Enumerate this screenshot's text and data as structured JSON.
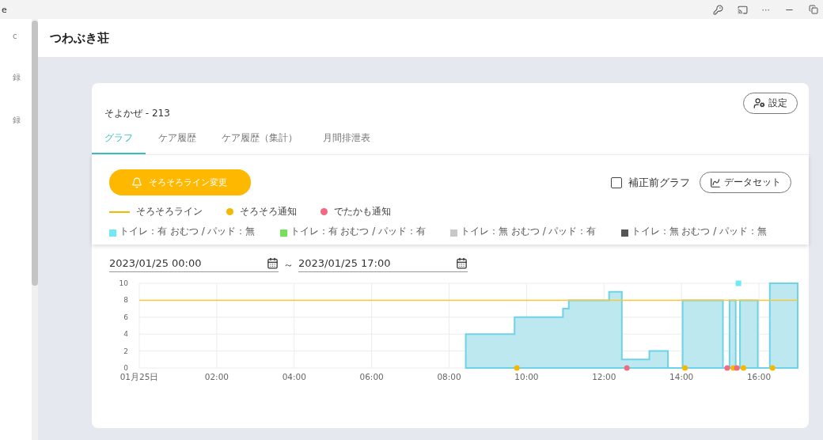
{
  "browser_bar": {
    "title_fragment": "e",
    "more": "···"
  },
  "sidebar": {
    "fragments": [
      "c",
      "録",
      "録"
    ]
  },
  "header": {
    "title": "つわぶき荘"
  },
  "card": {
    "resident": "そよかぜ - 213",
    "settings_button": "設定",
    "tabs": [
      {
        "label": "グラフ",
        "selected": true
      },
      {
        "label": "ケア履歴",
        "selected": false
      },
      {
        "label": "ケア履歴（集計）",
        "selected": false
      },
      {
        "label": "月間排泄表",
        "selected": false
      }
    ],
    "alert_button": "そろそろライン変更",
    "raw_graph": {
      "label": "補正前グラフ",
      "checked": false
    },
    "dataset_button": "データセット",
    "legend": [
      {
        "kind": "line",
        "label": "そろそろライン",
        "color": "#f5b800"
      },
      {
        "kind": "dot",
        "label": "そろそろ通知",
        "color": "#f5b800"
      },
      {
        "kind": "dot",
        "label": "でたかも通知",
        "color": "#f06a82"
      }
    ],
    "status_legend": [
      {
        "label": "トイレ：有 おむつ / パッド：無",
        "color": "#6ee9f5"
      },
      {
        "label": "トイレ：有 おむつ / パッド：有",
        "color": "#77e05a"
      },
      {
        "label": "トイレ：無 おむつ / パッド：有",
        "color": "#c8c8c8"
      },
      {
        "label": "トイレ：無 おむつ / パッド：無",
        "color": "#555555"
      }
    ],
    "date_range": {
      "start": "2023/01/25 00:00",
      "separator": "～",
      "end": "2023/01/25 17:00"
    },
    "chart_data": {
      "type": "area",
      "x": [
        0,
        8.43,
        9.69,
        9.75,
        10.94,
        11.09,
        12.13,
        12.46,
        12.59,
        13.17,
        13.65,
        13.86,
        14.03,
        14.09,
        15.07,
        15.18,
        15.24,
        15.34,
        15.4,
        15.43,
        15.47,
        15.51,
        15.6,
        15.97,
        16.28,
        16.35,
        17
      ],
      "xlim": [
        0,
        17
      ],
      "ylim": [
        0,
        10
      ],
      "grid": true,
      "xticks": [
        {
          "value": 0,
          "label": "01月25日"
        },
        {
          "value": 2,
          "label": "02:00"
        },
        {
          "value": 4,
          "label": "04:00"
        },
        {
          "value": 6,
          "label": "06:00"
        },
        {
          "value": 8,
          "label": "08:00"
        },
        {
          "value": 10,
          "label": "10:00"
        },
        {
          "value": 12,
          "label": "12:00"
        },
        {
          "value": 14,
          "label": "14:00"
        },
        {
          "value": 16,
          "label": "16:00"
        }
      ],
      "yticks": [
        0,
        2,
        4,
        6,
        8,
        10
      ],
      "series": [
        {
          "type": "area",
          "color": "#6dd3e6",
          "values": [
            null,
            4,
            6,
            null,
            7,
            8,
            9,
            1,
            null,
            2,
            0,
            0,
            8,
            null,
            0,
            null,
            8,
            null,
            0,
            null,
            null,
            8,
            null,
            0,
            10,
            null,
            10
          ]
        },
        {
          "type": "line",
          "color": "#f5c842",
          "values": [
            8,
            null,
            null,
            null,
            null,
            null,
            null,
            null,
            null,
            null,
            null,
            null,
            null,
            null,
            null,
            null,
            null,
            null,
            null,
            null,
            null,
            null,
            null,
            null,
            null,
            null,
            8
          ]
        },
        {
          "type": "scatter",
          "color": "#f5b800",
          "values": [
            null,
            null,
            null,
            0,
            null,
            null,
            null,
            null,
            null,
            null,
            null,
            null,
            null,
            0,
            null,
            null,
            null,
            0,
            null,
            null,
            null,
            null,
            0,
            null,
            null,
            0,
            null
          ]
        },
        {
          "type": "scatter",
          "color": "#f06a82",
          "values": [
            null,
            null,
            null,
            null,
            null,
            null,
            null,
            null,
            0,
            null,
            null,
            null,
            null,
            null,
            null,
            0,
            null,
            null,
            null,
            0,
            null,
            null,
            null,
            null,
            null,
            null,
            null
          ]
        },
        {
          "type": "scatter",
          "color": "#6ee9f5",
          "values": [
            null,
            null,
            null,
            null,
            null,
            null,
            null,
            null,
            null,
            null,
            null,
            null,
            null,
            null,
            null,
            null,
            null,
            null,
            null,
            null,
            10,
            null,
            null,
            null,
            null,
            null,
            null
          ]
        }
      ]
    }
  }
}
